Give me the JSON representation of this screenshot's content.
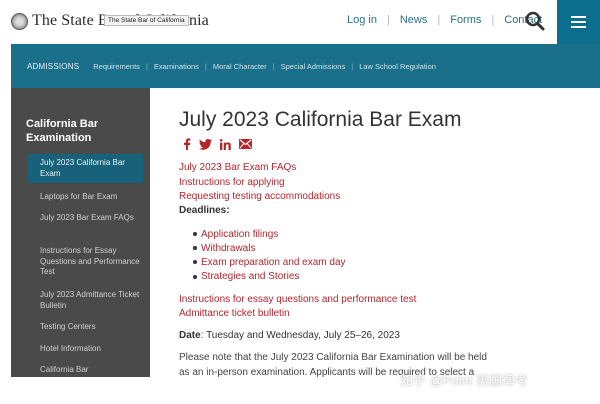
{
  "header": {
    "logo_text": "The State Bar of California",
    "logo_tooltip": "The State Bar of California",
    "nav": [
      "Log in",
      "News",
      "Forms",
      "Contact"
    ]
  },
  "subnav": {
    "label": "ADMISSIONS",
    "links": [
      "Requirements",
      "Examinations",
      "Moral Character",
      "Special Admissions",
      "Law School Regulation"
    ]
  },
  "sidebar": {
    "title": "California Bar Examination",
    "items": [
      "July 2023 California Bar Exam",
      "Laptops for Bar Exam",
      "July 2023 Bar Exam FAQs",
      "Instructions for Essay Questions and Performance Test",
      "July 2023 Admittance Ticket Bulletin",
      "Testing Centers",
      "Hotel Information",
      "California Bar"
    ]
  },
  "main": {
    "title": "July 2023 California Bar Exam",
    "links_top": [
      "July 2023 Bar Exam FAQs",
      "Instructions for applying",
      "Requesting testing accommodations"
    ],
    "deadlines_label": "Deadlines:",
    "deadlines": [
      "Application filings",
      "Withdrawals",
      "Exam preparation and exam day",
      "Strategies and Stories"
    ],
    "links_bottom": [
      "Instructions for essay questions and performance test",
      "Admittance ticket bulletin"
    ],
    "date_label": "Date",
    "date_value": ": Tuesday and Wednesday, July 25–26, 2023",
    "note": "Please note that the July 2023 California Bar Examination will be held as an in-person examination. Applicants will be required to select a testing"
  },
  "watermark": "知乎 @Point 美国律考",
  "colors": {
    "brand_teal": "#1a6f8b",
    "link_red": "#b3262d",
    "sidebar_gray": "#4a4a4a"
  }
}
